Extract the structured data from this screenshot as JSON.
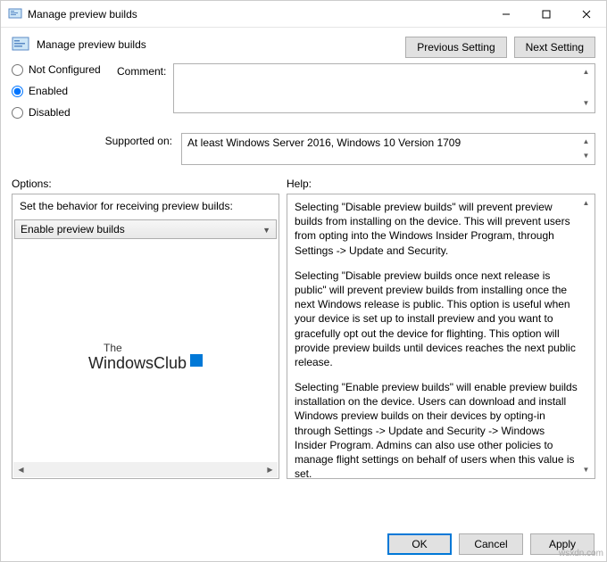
{
  "titlebar": {
    "title": "Manage preview builds"
  },
  "header": {
    "title": "Manage preview builds"
  },
  "nav": {
    "prev": "Previous Setting",
    "next": "Next Setting"
  },
  "state": {
    "not_configured": "Not Configured",
    "enabled": "Enabled",
    "disabled": "Disabled",
    "selected": "enabled"
  },
  "comment": {
    "label": "Comment:",
    "value": ""
  },
  "supported": {
    "label": "Supported on:",
    "value": "At least Windows Server 2016, Windows 10 Version 1709"
  },
  "section_labels": {
    "options": "Options:",
    "help": "Help:"
  },
  "options": {
    "behavior_label": "Set the behavior for receiving preview builds:",
    "dropdown_value": "Enable preview builds"
  },
  "help": {
    "p1": "Selecting \"Disable preview builds\" will prevent preview builds from installing on the device. This will prevent users from opting into the Windows Insider Program, through Settings -> Update and Security.",
    "p2": "Selecting \"Disable preview builds once next release is public\" will prevent preview builds from installing once the next Windows release is public. This option is useful when your device is set up to install preview and you want to gracefully opt out the device for flighting. This option will provide preview builds until devices reaches the next public release.",
    "p3": "Selecting \"Enable preview builds\" will enable preview builds installation on the device. Users can download and install Windows preview builds on their devices by opting-in through Settings -> Update and Security -> Windows Insider Program. Admins can also use other policies to manage flight settings on behalf of users when this value is set."
  },
  "watermark": {
    "line1": "The",
    "line2": "WindowsClub"
  },
  "footer": {
    "ok": "OK",
    "cancel": "Cancel",
    "apply": "Apply"
  },
  "attribution": "wsxdn.com"
}
